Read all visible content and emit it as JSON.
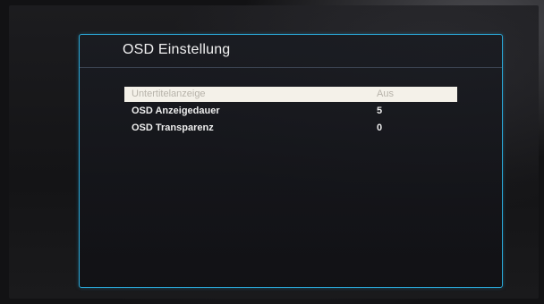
{
  "osd": {
    "title": "OSD Einstellung",
    "items": [
      {
        "label": "Untertitelanzeige",
        "value": "Aus",
        "selected": true
      },
      {
        "label": "OSD Anzeigedauer",
        "value": "5",
        "selected": false
      },
      {
        "label": "OSD Transparenz",
        "value": "0",
        "selected": false
      }
    ]
  },
  "colors": {
    "border_accent": "#2aa7d6",
    "highlight_bg": "#f4f1e9",
    "text": "#ededed"
  }
}
